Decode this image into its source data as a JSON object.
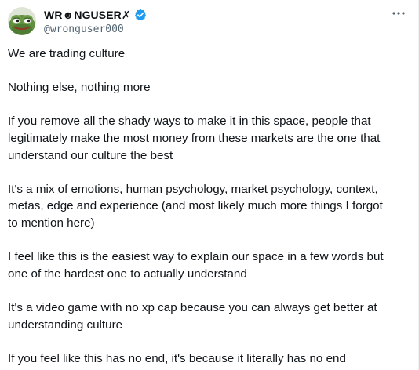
{
  "author": {
    "display_name": "WR☻NGUSER✗",
    "handle": "@wronguser000",
    "avatar_icon": "frog-avatar-icon",
    "verified_icon": "verified-badge-icon",
    "verified_color": "#1d9bf0"
  },
  "menu": {
    "more_icon": "more-dots-icon"
  },
  "tweet": {
    "paragraphs": [
      "We are trading culture",
      "Nothing else, nothing more",
      "If you remove all the shady ways to make it in this space, people that\nlegitimately make the most money from these markets are the one that\nunderstand our culture the best",
      "It's a mix of emotions, human psychology, market psychology, context,\nmetas, edge and experience (and most likely much more things I forgot\nto mention here)",
      "I feel like this is the easiest way to explain our space in a few words but\none of the hardest one to actually understand",
      "It's a video game with no xp cap because you can always get better at\nunderstanding culture",
      "If you feel like this has no end, it's because it literally has no end"
    ]
  }
}
